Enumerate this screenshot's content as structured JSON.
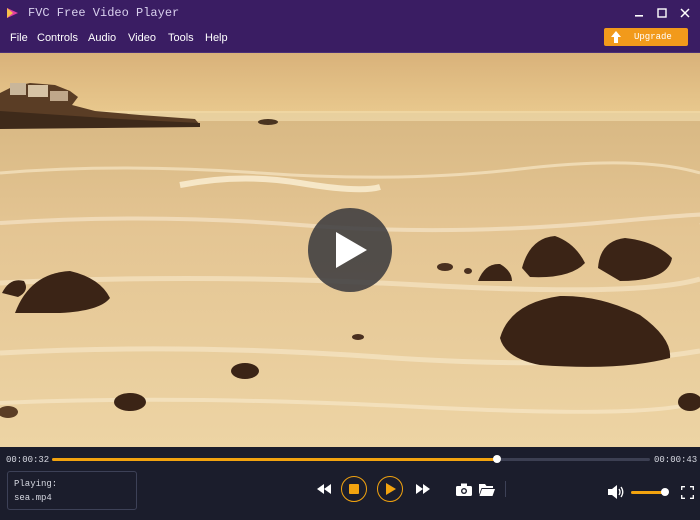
{
  "window": {
    "title": "FVC Free Video Player",
    "controls": [
      "minimize-icon",
      "maximize-icon",
      "close-icon"
    ]
  },
  "menu": {
    "items": [
      "File",
      "Controls",
      "Audio",
      "Video",
      "Tools",
      "Help"
    ]
  },
  "upgrade": {
    "label": "Upgrade",
    "color": "#f29a1b"
  },
  "player": {
    "current_time": "00:00:32",
    "total_time": "00:00:43",
    "progress": 0.744,
    "volume": 0.9,
    "playing_label": "Playing:",
    "file_name": "sea.mp4",
    "accent": "#f2a30f",
    "controls": [
      "rewind-icon",
      "stop-icon",
      "play-icon",
      "fast-forward-icon",
      "snapshot-icon",
      "folder-icon",
      "volume-icon",
      "fullscreen-icon"
    ]
  }
}
